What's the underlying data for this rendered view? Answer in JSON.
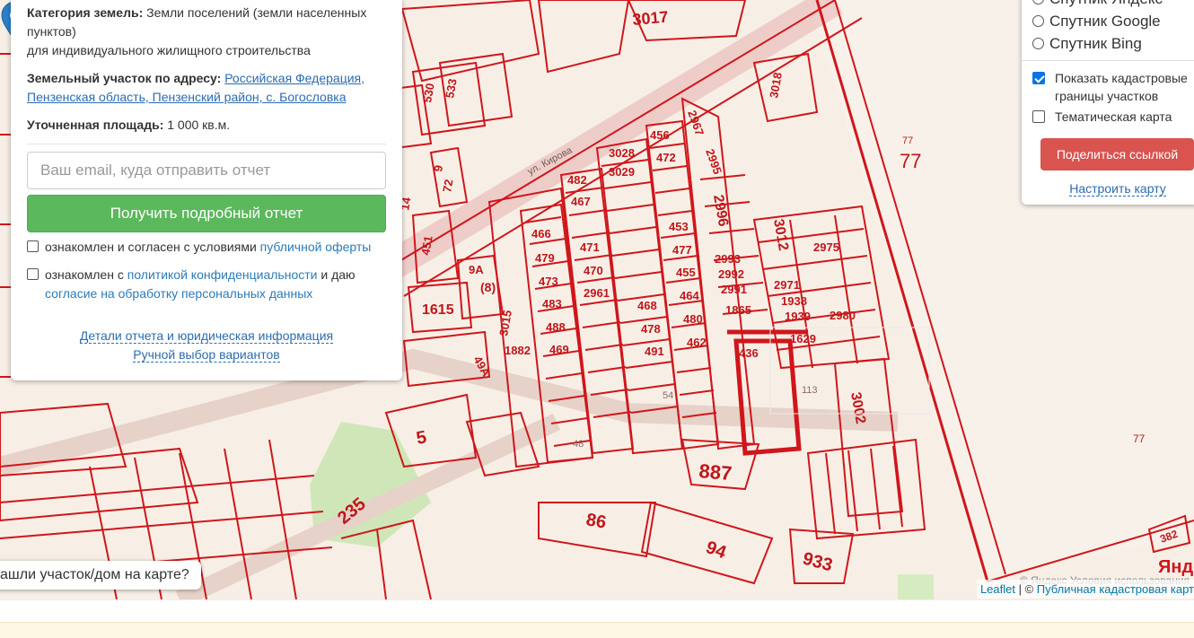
{
  "info": {
    "category_label": "Категория земель:",
    "category_value": "Земли поселений (земли населенных пунктов)",
    "category_use": "для индивидуального жилищного строительства",
    "address_label": "Земельный участок по адресу:",
    "address_link": "Российская Федерация, Пензенская область, Пензенский район, с. Богословка",
    "area_label": "Уточненная площадь:",
    "area_value": "1 000 кв.м.",
    "email_placeholder": "Ваш email, куда отправить отчет",
    "report_button": "Получить подробный отчет",
    "consent1_prefix": "ознакомлен и согласен с условиями ",
    "consent1_link": "публичной оферты",
    "consent2_prefix": "ознакомлен с ",
    "consent2_link": "политикой конфиденциальности",
    "consent2_mid": " и даю",
    "consent2_link2": "согласие на обработку персональных данных",
    "details_link": "Детали отчета и юридическая информация",
    "manual_link": "Ручной выбор вариантов"
  },
  "layers": {
    "radio_yandex": "Спутник Яндекс",
    "radio_google": "Спутник Google",
    "radio_bing": "Спутник Bing",
    "show_cadastral": "Показать кадастровые границы участков",
    "show_cadastral_checked": true,
    "thematic": "Тематическая карта",
    "thematic_checked": false,
    "share_button": "Поделиться ссылкой",
    "setup_link": "Настроить карту"
  },
  "map": {
    "found_prompt": "ашли участок/дом на карте?",
    "attribution_leaflet": "Leaflet",
    "attribution_sep": " | © ",
    "attribution_pkk": "Публичная кадастровая карт",
    "yandex_copyright": "© Яндекс  Условия использования",
    "parcel_labels": [
      "3017",
      "3018",
      "530",
      "533",
      "9",
      "72",
      "14",
      "451",
      "9А",
      "8",
      "1615",
      "3015",
      "49А",
      "1882",
      "482",
      "467",
      "466",
      "479",
      "473",
      "483",
      "488",
      "469",
      "471",
      "470",
      "2961",
      "3028",
      "3029",
      "456",
      "472",
      "453",
      "477",
      "455",
      "464",
      "480",
      "462",
      "468",
      "478",
      "491",
      "2967",
      "2995",
      "2996",
      "2993",
      "2992",
      "2991",
      "1865",
      "3012",
      "2975",
      "2971",
      "1938",
      "1939",
      "2980",
      "1629",
      "436",
      "113",
      "3002",
      "54",
      "48",
      "5",
      "887",
      "86",
      "94",
      "933",
      "235",
      "77",
      "382"
    ],
    "street_label": "ул. Кирова",
    "yandex_logo": "Янде"
  },
  "colors": {
    "cadastral_red": "#d0161b",
    "green_btn": "#5cb85c",
    "red_btn": "#d9534f",
    "link_blue": "#2b6cb0",
    "marker_blue": "#2a81cb"
  }
}
